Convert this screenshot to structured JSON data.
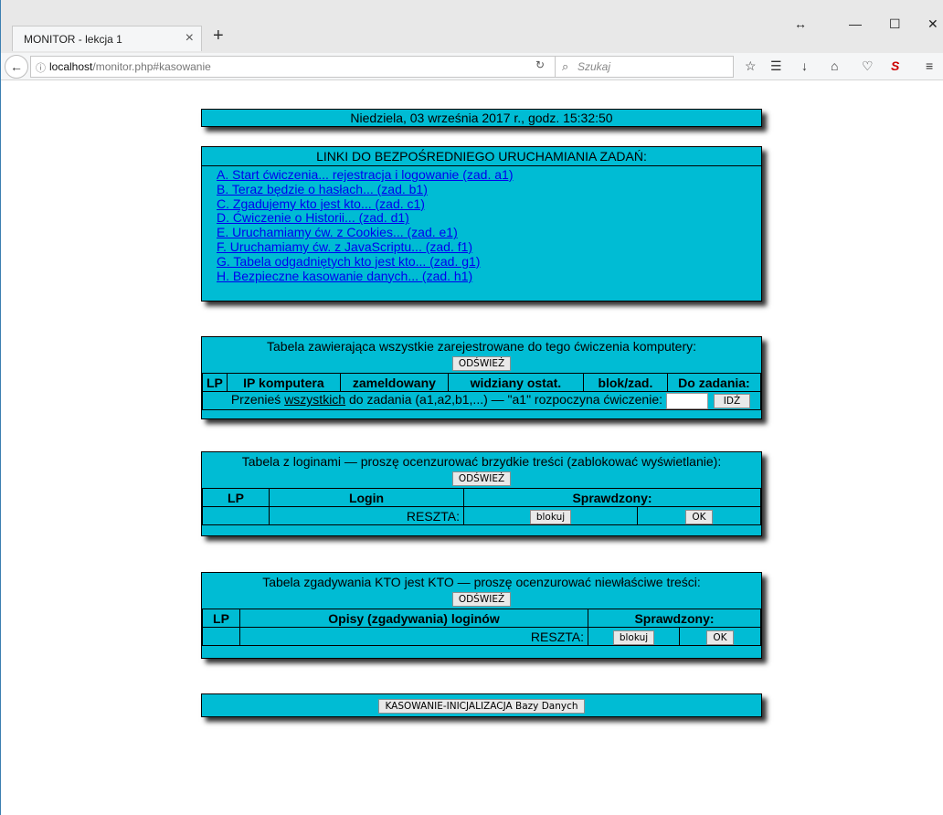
{
  "browser": {
    "tab_title": "MONITOR - lekcja 1",
    "tab_close": "×",
    "new_tab": "+",
    "url_host": "localhost",
    "url_path": "/monitor.php#kasowanie",
    "search_placeholder": "Szukaj",
    "window_buttons": [
      "↔",
      "—",
      "☐",
      "✕"
    ]
  },
  "date_line": "Niedziela, 03 września 2017 r., godz. 15:32:50",
  "links_section": {
    "title": "LINKI DO BEZPOŚREDNIEGO URUCHAMIANIA ZADAŃ:",
    "links": [
      "A. Start ćwiczenia... rejestracja i logowanie (zad. a1)",
      "B. Teraz będzie o hasłach... (zad. b1)",
      "C. Zgadujemy kto jest kto... (zad. c1)",
      "D. Ćwiczenie o Historii... (zad. d1)",
      "E. Uruchamiamy ćw. z Cookies... (zad. e1)",
      "F. Uruchamiamy ćw. z JavaScriptu... (zad. f1)",
      "G. Tabela odgadniętych kto jest kto... (zad. g1)",
      "H. Bezpieczne kasowanie danych... (zad. h1)"
    ]
  },
  "computers_table": {
    "caption": "Tabela zawierająca wszystkie zarejestrowane do tego ćwiczenia komputery:",
    "refresh": "ODŚWIEŻ",
    "headers": [
      "LP",
      "IP komputera",
      "zameldowany",
      "widziany ostat.",
      "blok/zad.",
      "Do zadania:"
    ],
    "move_prefix": "Przenieś ",
    "move_link": "wszystkich",
    "move_suffix": " do zadania (a1,a2,b1,...) — \"a1\" rozpoczyna ćwiczenie:",
    "go_button": "IDŹ"
  },
  "logins_table": {
    "caption": "Tabela z loginami — proszę ocenzurować brzydkie treści (zablokować wyświetlanie):",
    "refresh": "ODŚWIEŻ",
    "headers": [
      "LP",
      "Login",
      "Sprawdzony:"
    ],
    "rest_label": "RESZTA:",
    "block_button": "blokuj",
    "ok_button": "OK"
  },
  "guess_table": {
    "caption": "Tabela zgadywania KTO jest KTO — proszę ocenzurować niewłaściwe treści:",
    "refresh": "ODŚWIEŻ",
    "headers": [
      "LP",
      "Opisy (zgadywania) loginów",
      "Sprawdzony:"
    ],
    "rest_label": "RESZTA:",
    "block_button": "blokuj",
    "ok_button": "OK"
  },
  "reset_button": "KASOWANIE-INICJALIZACJA Bazy Danych",
  "colors": {
    "box_bg": "#00bcd4",
    "link": "#0000ee"
  }
}
